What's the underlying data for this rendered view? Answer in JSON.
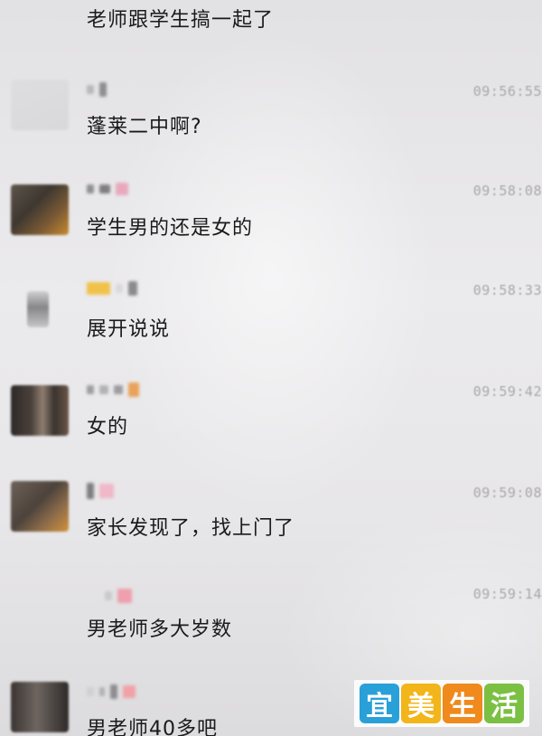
{
  "chat": {
    "messages": [
      {
        "sender_hidden": true,
        "time": "",
        "text": "老师跟学生搞一起了",
        "avatar": "blurred"
      },
      {
        "sender_hidden": true,
        "time": "09:56:55",
        "text": "蓬莱二中啊?",
        "avatar": "blurred"
      },
      {
        "sender_hidden": true,
        "time": "09:58:08",
        "text": "学生男的还是女的",
        "avatar": "blurred"
      },
      {
        "sender_hidden": true,
        "time": "09:58:33",
        "text": "展开说说",
        "avatar": "blurred"
      },
      {
        "sender_hidden": true,
        "time": "09:59:42",
        "text": "女的",
        "avatar": "blurred"
      },
      {
        "sender_hidden": true,
        "time": "09:59:08",
        "text": "家长发现了，找上门了",
        "avatar": "blurred"
      },
      {
        "sender_hidden": true,
        "time": "09:59:14",
        "text": "男老师多大岁数",
        "avatar": "blurred"
      },
      {
        "sender_hidden": true,
        "time": "",
        "text": "男老师40多吧",
        "avatar": "blurred"
      }
    ]
  },
  "watermark": {
    "chars": [
      "宜",
      "美",
      "生",
      "活"
    ],
    "colors": [
      "#2aa0d8",
      "#f2b51a",
      "#f08a1c",
      "#7bc043"
    ]
  },
  "colors": {
    "background": "#e9e8ea",
    "text": "#1a1a1a",
    "timestamp": "#a9a8ab"
  }
}
